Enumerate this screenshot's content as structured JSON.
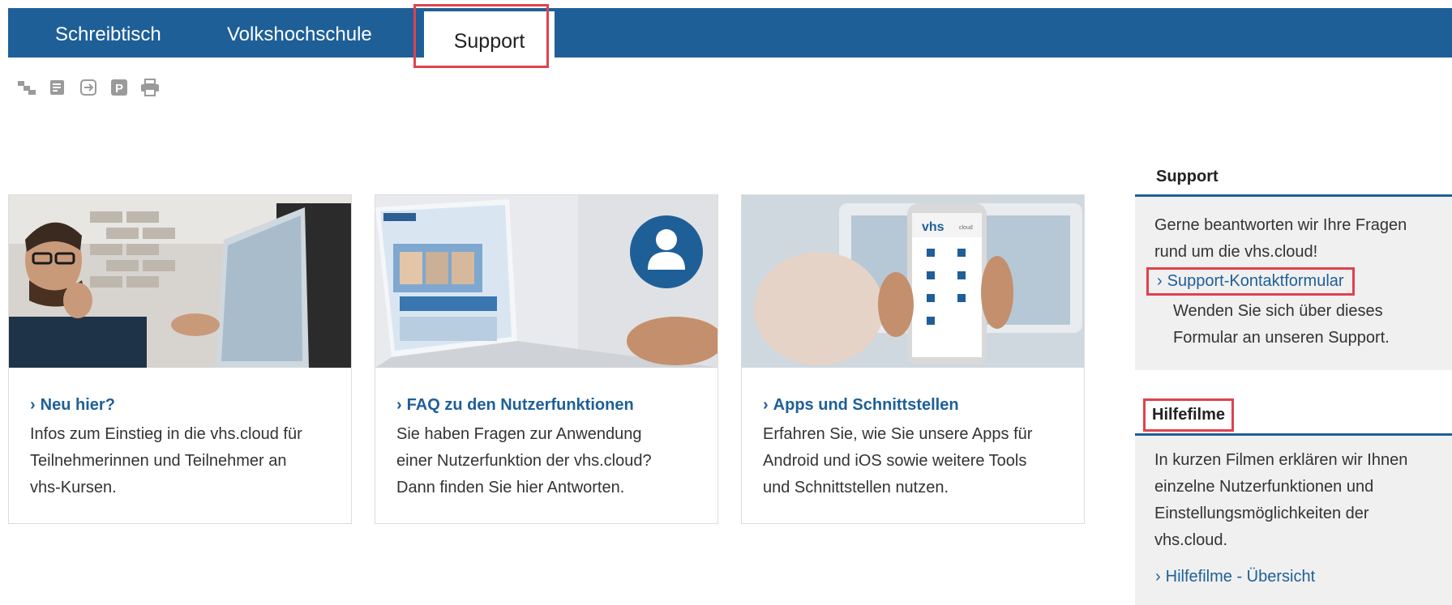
{
  "nav": {
    "tabs": [
      {
        "label": "Schreibtisch"
      },
      {
        "label": "Volkshochschule"
      },
      {
        "label": "Support"
      }
    ]
  },
  "toolbar": {
    "icons": [
      "sitemap-icon",
      "notes-icon",
      "login-icon",
      "parking-icon",
      "print-icon"
    ]
  },
  "cards": [
    {
      "title": "Neu hier?",
      "lines": [
        "Infos zum Einstieg in die vhs.cloud für",
        "Teilnehmerinnen und Teilnehmer an",
        "vhs-Kursen."
      ]
    },
    {
      "title": "FAQ zu den Nutzerfunktionen",
      "lines": [
        "Sie haben Fragen zur Anwendung",
        "einer Nutzerfunktion der vhs.cloud?",
        "Dann finden Sie hier Antworten."
      ]
    },
    {
      "title": "Apps und Schnittstellen",
      "lines": [
        "Erfahren Sie, wie Sie unsere Apps für",
        "Android und iOS sowie weitere Tools",
        "und Schnittstellen nutzen."
      ]
    }
  ],
  "sidebar": {
    "support": {
      "heading": "Support",
      "text_lines": [
        "Gerne beantworten wir Ihre Fragen",
        "rund um die vhs.cloud!"
      ],
      "link": "Support-Kontaktformular",
      "link_desc_lines": [
        "Wenden Sie sich über dieses",
        "Formular an unseren Support."
      ]
    },
    "hilfefilme": {
      "heading": "Hilfefilme",
      "text_lines": [
        "In kurzen Filmen erklären wir Ihnen",
        "einzelne Nutzerfunktionen und",
        "Einstellungsmöglichkeiten der",
        "vhs.cloud."
      ],
      "link": "Hilfefilme - Übersicht"
    }
  },
  "colors": {
    "nav_bg": "#1e5f98",
    "link": "#1e5f98",
    "highlight": "#e0424f"
  },
  "logo_text": "vhs",
  "logo_sub": "cloud"
}
